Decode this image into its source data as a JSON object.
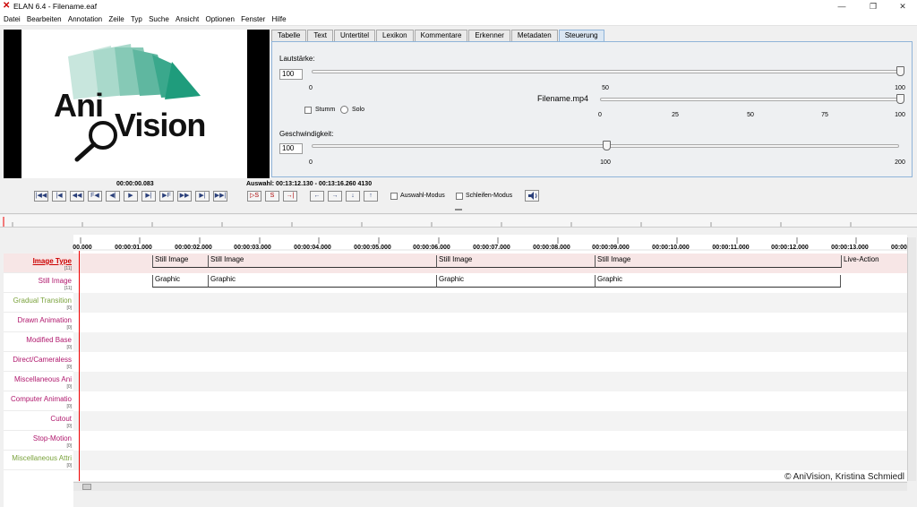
{
  "window": {
    "title": "ELAN 6.4 - Filename.eaf",
    "app_icon": "x-icon",
    "minimize": "—",
    "maximize": "❐",
    "close": "✕"
  },
  "menu": [
    "Datei",
    "Bearbeiten",
    "Annotation",
    "Zeile",
    "Typ",
    "Suche",
    "Ansicht",
    "Optionen",
    "Fenster",
    "Hilfe"
  ],
  "video": {
    "logo_text_1": "Ani",
    "logo_text_2": "Vision"
  },
  "tabs": [
    "Tabelle",
    "Text",
    "Untertitel",
    "Lexikon",
    "Kommentare",
    "Erkenner",
    "Metadaten",
    "Steuerung"
  ],
  "selected_tab": "Steuerung",
  "controls": {
    "volume_label": "Lautstärke:",
    "volume_value": "100",
    "volume_ticks": [
      "0",
      "50",
      "100"
    ],
    "mute_label": "Stumm",
    "solo_label": "Solo",
    "media_file": "Filename.mp4",
    "media_ticks": [
      "0",
      "25",
      "50",
      "75",
      "100"
    ],
    "speed_label": "Geschwindigkeit:",
    "speed_value": "100",
    "speed_ticks": [
      "0",
      "100",
      "200"
    ]
  },
  "player": {
    "time": "00:00:00.083",
    "selection": "Auswahl: 00:13:12.130 - 00:13:16.260  4130",
    "selection_mode": "Auswahl-Modus",
    "loop_mode": "Schleifen-Modus",
    "nav_buttons": [
      "|◀◀",
      "|◀",
      "◀◀",
      "F◀",
      "◀|",
      "▶",
      "▶|",
      "▶F",
      "▶▶",
      "▶|",
      "▶▶|"
    ],
    "sel_buttons": [
      "▷S",
      "S",
      "→|"
    ],
    "arrow_buttons": [
      "←",
      "→",
      "↓",
      "↑"
    ]
  },
  "ruler": [
    "00.000",
    "00:00:01.000",
    "00:00:02.000",
    "00:00:03.000",
    "00:00:04.000",
    "00:00:05.000",
    "00:00:06.000",
    "00:00:07.000",
    "00:00:08.000",
    "00:00:09.000",
    "00:00:10.000",
    "00:00:11.000",
    "00:00:12.000",
    "00:00:13.000",
    "00:00"
  ],
  "tiers": [
    {
      "name": "Image Type",
      "count": "[11]",
      "color": "#cc0000",
      "active": true
    },
    {
      "name": "Still Image",
      "count": "[11]",
      "color": "#b0186d"
    },
    {
      "name": "Gradual Transition",
      "count": "[0]",
      "color": "#7aa23c"
    },
    {
      "name": "Drawn Animation",
      "count": "[0]",
      "color": "#b0186d"
    },
    {
      "name": "Modified Base",
      "count": "[0]",
      "color": "#b0186d"
    },
    {
      "name": "Direct/Cameraless",
      "count": "[0]",
      "color": "#b0186d"
    },
    {
      "name": "Miscellaneous Ani",
      "count": "[0]",
      "color": "#b0186d"
    },
    {
      "name": "Computer Animatio",
      "count": "[0]",
      "color": "#b0186d"
    },
    {
      "name": "Cutout",
      "count": "[0]",
      "color": "#b0186d"
    },
    {
      "name": "Stop-Motion",
      "count": "[0]",
      "color": "#b0186d"
    },
    {
      "name": "Miscellaneous Attri",
      "count": "[0]",
      "color": "#7aa23c"
    }
  ],
  "annotations_row1": [
    "Still Image",
    "Still Image",
    "Still Image",
    "Still Image",
    "Live-Action"
  ],
  "annotations_row2": [
    "Graphic",
    "Graphic",
    "Graphic",
    "Graphic"
  ],
  "copyright": "© AniVision, Kristina Schmiedl"
}
